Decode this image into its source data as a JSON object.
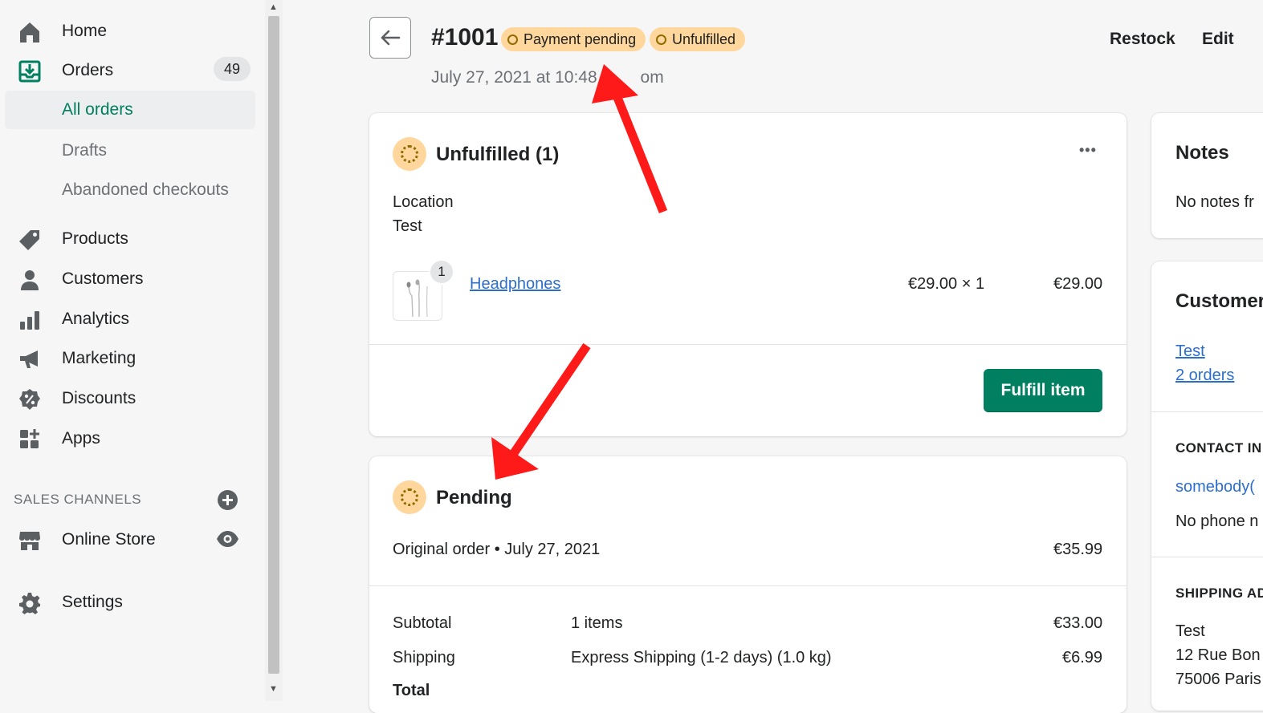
{
  "sidebar": {
    "home": "Home",
    "orders": "Orders",
    "orders_count": "49",
    "all_orders": "All orders",
    "drafts": "Drafts",
    "abandoned": "Abandoned checkouts",
    "products": "Products",
    "customers": "Customers",
    "analytics": "Analytics",
    "marketing": "Marketing",
    "discounts": "Discounts",
    "apps": "Apps",
    "sales_channels": "SALES CHANNELS",
    "online_store": "Online Store",
    "settings": "Settings"
  },
  "header": {
    "order_number": "#1001",
    "payment_status": "Payment pending",
    "fulfillment_status": "Unfulfilled",
    "date_visible_start": "July 27, 2021 at 10:48",
    "date_visible_end": "om",
    "restock": "Restock",
    "edit": "Edit"
  },
  "unfulfilled_card": {
    "title": "Unfulfilled (1)",
    "more": "•••",
    "location_label": "Location",
    "location_value": "Test",
    "item_qty": "1",
    "item_name": "Headphones",
    "item_price": "€29.00 × 1",
    "item_total": "€29.00",
    "fulfill_button": "Fulfill item"
  },
  "pending_card": {
    "title": "Pending",
    "original_order": "Original order • July 27, 2021",
    "original_amount": "€35.99",
    "subtotal_label": "Subtotal",
    "subtotal_desc": "1 items",
    "subtotal_amount": "€33.00",
    "shipping_label": "Shipping",
    "shipping_desc": "Express Shipping (1-2 days) (1.0 kg)",
    "shipping_amount": "€6.99",
    "total_label": "Total"
  },
  "right_column": {
    "notes_title": "Notes",
    "notes_text": "No notes fr",
    "customer_title": "Customer",
    "customer_name": "Test",
    "customer_orders": "2 orders",
    "contact_head": "CONTACT IN",
    "contact_email": "somebody(",
    "contact_phone": "No phone n",
    "shipping_head": "SHIPPING AD",
    "addr_1": "Test",
    "addr_2": "12 Rue Bon",
    "addr_3": "75006 Paris"
  },
  "colors": {
    "brand_green": "#008060",
    "link_blue": "#2c6ecb",
    "warning_yellow": "#ffd79d",
    "annotation_red": "#ff1a1a"
  }
}
